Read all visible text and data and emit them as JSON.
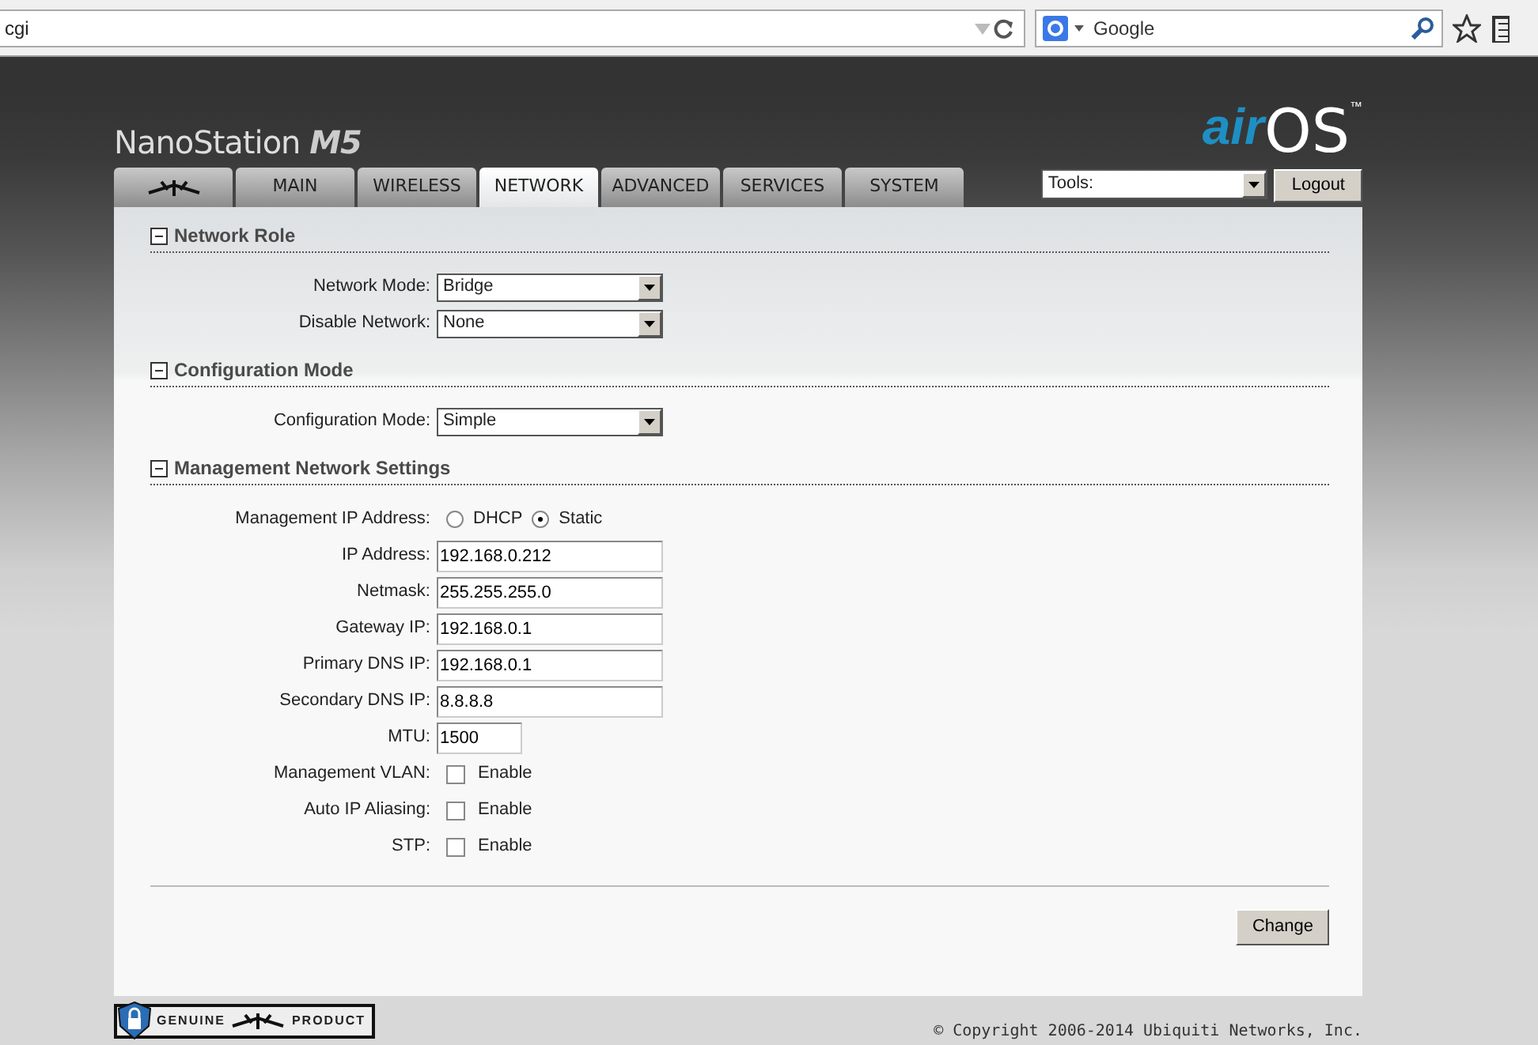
{
  "browser": {
    "address": "cgi",
    "search_placeholder": "Google"
  },
  "header": {
    "product": "NanoStation",
    "model": "M5",
    "logo_air": "air",
    "logo_os": "OS",
    "trademark": "™"
  },
  "tabs": [
    {
      "kind": "icon",
      "selected": false
    },
    {
      "kind": "text",
      "label": "MAIN",
      "selected": false
    },
    {
      "kind": "text",
      "label": "WIRELESS",
      "selected": false
    },
    {
      "kind": "text",
      "label": "NETWORK",
      "selected": true
    },
    {
      "kind": "text",
      "label": "ADVANCED",
      "selected": false
    },
    {
      "kind": "text",
      "label": "SERVICES",
      "selected": false
    },
    {
      "kind": "text",
      "label": "SYSTEM",
      "selected": false
    }
  ],
  "tools": {
    "value": "Tools:"
  },
  "logout": "Logout",
  "sections": [
    {
      "title": "Network Role",
      "expanded": true,
      "fields": [
        {
          "kind": "select",
          "label": "Network Mode:",
          "value": "Bridge"
        },
        {
          "kind": "select",
          "label": "Disable Network:",
          "value": "None"
        }
      ]
    },
    {
      "title": "Configuration Mode",
      "expanded": true,
      "fields": [
        {
          "kind": "select",
          "label": "Configuration Mode:",
          "value": "Simple"
        }
      ]
    },
    {
      "title": "Management Network Settings",
      "expanded": true,
      "fields": [
        {
          "kind": "radio",
          "label": "Management IP Address:",
          "options": [
            {
              "label": "DHCP",
              "selected": false
            },
            {
              "label": "Static",
              "selected": true
            }
          ]
        },
        {
          "kind": "text",
          "label": "IP Address:",
          "value": "192.168.0.212"
        },
        {
          "kind": "text",
          "label": "Netmask:",
          "value": "255.255.255.0"
        },
        {
          "kind": "text",
          "label": "Gateway IP:",
          "value": "192.168.0.1"
        },
        {
          "kind": "text",
          "label": "Primary DNS IP:",
          "value": "192.168.0.1"
        },
        {
          "kind": "text",
          "label": "Secondary DNS IP:",
          "value": "8.8.8.8"
        },
        {
          "kind": "short_text",
          "label": "MTU:",
          "value": "1500"
        },
        {
          "kind": "checkbox",
          "label": "Management VLAN:",
          "option": "Enable",
          "checked": false
        },
        {
          "kind": "checkbox",
          "label": "Auto IP Aliasing:",
          "option": "Enable",
          "checked": false
        },
        {
          "kind": "checkbox",
          "label": "STP:",
          "option": "Enable",
          "checked": false
        }
      ]
    }
  ],
  "change_button": "Change",
  "footer": {
    "badge_left": "GENUINE",
    "badge_right": "PRODUCT",
    "copyright": "© Copyright 2006-2014 Ubiquiti Networks, Inc."
  }
}
